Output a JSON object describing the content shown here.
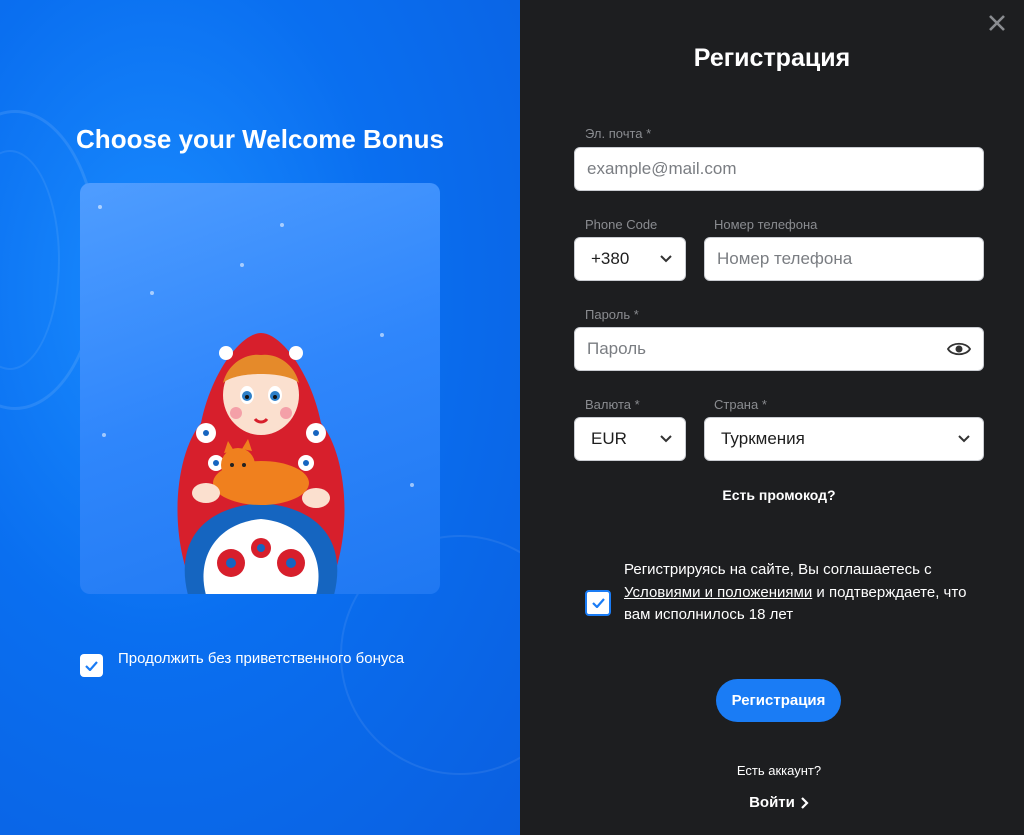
{
  "left": {
    "title": "Choose your Welcome Bonus",
    "continue_without_bonus": {
      "label": "Продолжить без приветственного бонуса",
      "checked": true
    }
  },
  "modal": {
    "close_icon": "close-icon",
    "title": "Регистрация",
    "email": {
      "label": "Эл. почта *",
      "placeholder": "example@mail.com"
    },
    "phone_code": {
      "label": "Phone Code",
      "value": "+380"
    },
    "phone": {
      "label": "Номер телефона",
      "placeholder": "Номер телефона"
    },
    "password": {
      "label": "Пароль *",
      "placeholder": "Пароль",
      "toggle_icon": "eye-icon"
    },
    "currency": {
      "label": "Валюта *",
      "value": "EUR"
    },
    "country": {
      "label": "Страна *",
      "value": "Туркмения"
    },
    "promo_link": "Есть промокод?",
    "terms": {
      "checked": true,
      "text_before": "Регистрируясь на сайте, Вы соглашаетесь с ",
      "link": "Условиями и положениями",
      "text_after": " и подтверждаете, что вам исполнилось 18 лет"
    },
    "submit_label": "Регистрация",
    "have_account": "Есть аккаунт?",
    "login_label": "Войти"
  },
  "colors": {
    "accent": "#1a7cf5",
    "right_bg": "#1d1e20",
    "left_bg": "#0a6ff0"
  }
}
